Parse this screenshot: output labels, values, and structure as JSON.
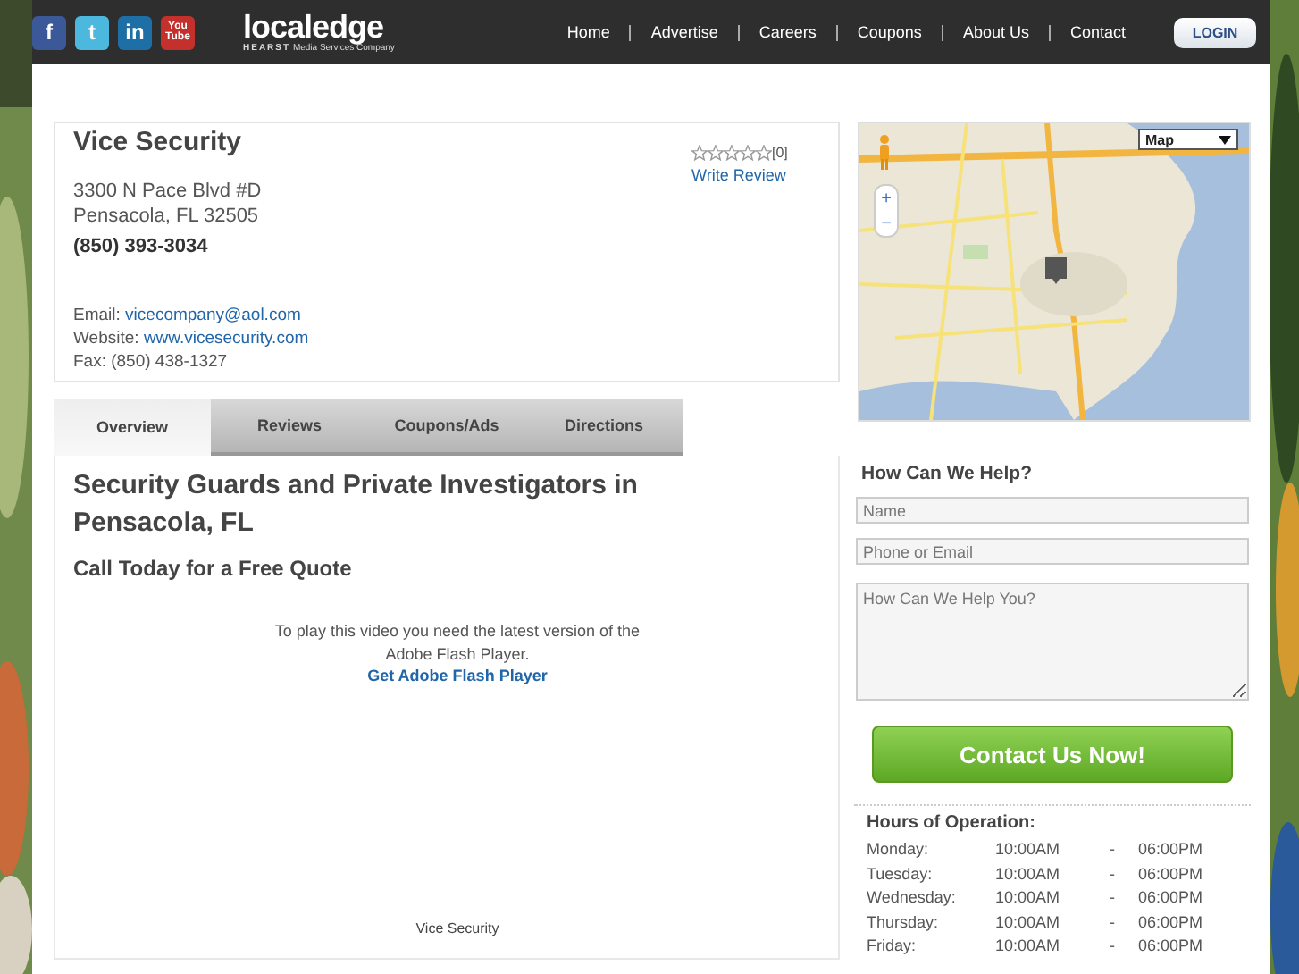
{
  "header": {
    "social": [
      {
        "glyph": "f",
        "color": "#3b5998"
      },
      {
        "glyph": "t",
        "color": "#4cb8de"
      },
      {
        "glyph": "in",
        "color": "#1d6fa5"
      },
      {
        "glyph": "You Tube",
        "color": "#c4302b"
      }
    ],
    "logo": {
      "name": "localedge",
      "tagline_brand": "HEARST",
      "tagline": "Media Services Company"
    },
    "nav": [
      "Home",
      "Advertise",
      "Careers",
      "Coupons",
      "About Us",
      "Contact"
    ],
    "login": "LOGIN"
  },
  "business": {
    "name": "Vice Security",
    "address": [
      "3300 N Pace Blvd #D",
      "Pensacola, FL 32505"
    ],
    "phone": "(850) 393-3034",
    "email_label": "Email:",
    "email": "vicecompany@aol.com",
    "website_label": "Website:",
    "website": "www.vicesecurity.com",
    "fax": "Fax: (850) 438-1327",
    "stars": 0,
    "review_count": "[0]",
    "write_review": "Write Review"
  },
  "tabs": [
    {
      "label": "Overview",
      "selected": true
    },
    {
      "label": "Reviews",
      "selected": false
    },
    {
      "label": "Coupons/Ads",
      "selected": false
    },
    {
      "label": "Directions",
      "selected": false
    }
  ],
  "overview": {
    "title": "Security Guards and Private Investigators in Pensacola, FL",
    "subtitle": "Call Today for a Free Quote",
    "flash_notice": "To play this video you need the latest version of the Adobe Flash Player.",
    "flash_link": "Get Adobe Flash Player",
    "caption": "Vice Security"
  },
  "map": {
    "kind": "picture",
    "type_selector": "Map",
    "zoom_in": "+",
    "zoom_out": "−"
  },
  "contact_form": {
    "title": "How Can We Help?",
    "fields": [
      {
        "kind": "input",
        "placeholder": "Name"
      },
      {
        "kind": "input",
        "placeholder": "Phone or Email"
      },
      {
        "kind": "textarea",
        "placeholder": "How Can We Help You?"
      }
    ],
    "submit": "Contact Us Now!"
  },
  "hours": {
    "title": "Hours of Operation:",
    "days": [
      {
        "day": "Monday:",
        "open": "10:00AM",
        "sep": "-",
        "close": "06:00PM"
      },
      {
        "day": "Tuesday:",
        "open": "10:00AM",
        "sep": "-",
        "close": "06:00PM"
      },
      {
        "day": "Wednesday:",
        "open": "10:00AM",
        "sep": "-",
        "close": "06:00PM"
      },
      {
        "day": "Thursday:",
        "open": "10:00AM",
        "sep": "-",
        "close": "06:00PM"
      },
      {
        "day": "Friday:",
        "open": "10:00AM",
        "sep": "-",
        "close": "06:00PM"
      }
    ]
  }
}
